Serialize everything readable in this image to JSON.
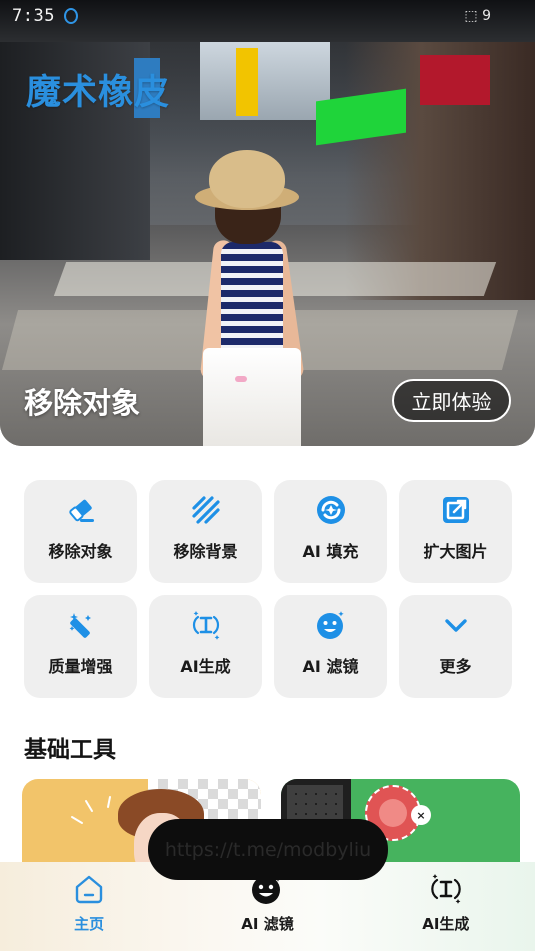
{
  "status_bar": {
    "time": "7:35",
    "right_glyphs": "⬚ 9"
  },
  "brand": {
    "name": "魔术橡皮"
  },
  "hero": {
    "title": "移除对象",
    "cta_label": "立即体验"
  },
  "tools": [
    {
      "label": "移除对象",
      "icon": "eraser-icon"
    },
    {
      "label": "移除背景",
      "icon": "diagonal-stripes-icon"
    },
    {
      "label": "AI 填充",
      "icon": "ai-fill-icon"
    },
    {
      "label": "扩大图片",
      "icon": "expand-image-icon"
    },
    {
      "label": "质量增强",
      "icon": "magic-wand-icon"
    },
    {
      "label": "AI生成",
      "icon": "ai-generate-icon"
    },
    {
      "label": "AI 滤镜",
      "icon": "smiley-sparkle-icon"
    },
    {
      "label": "更多",
      "icon": "chevron-down-icon"
    }
  ],
  "section": {
    "title": "基础工具"
  },
  "cards": [
    {
      "icon": "close-icon",
      "close_glyph": "×"
    }
  ],
  "toast": {
    "text": "https://t.me/modbyliu"
  },
  "bottom_nav": [
    {
      "label": "主页",
      "icon": "home-icon",
      "active": true
    },
    {
      "label": "AI 滤镜",
      "icon": "smiley-filter-icon",
      "active": false
    },
    {
      "label": "AI生成",
      "icon": "ai-generate-icon",
      "active": false
    }
  ],
  "colors": {
    "accent": "#2a8fde",
    "tile_bg": "#efefef",
    "text": "#1a1a1a"
  }
}
